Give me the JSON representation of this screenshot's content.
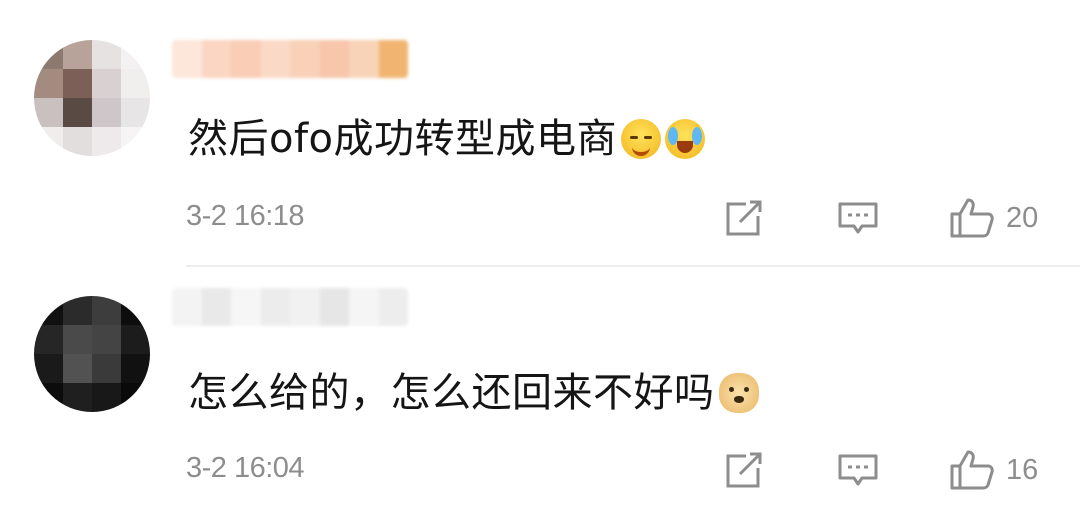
{
  "comments": [
    {
      "text": "然后ofo成功转型成电商",
      "emojis": [
        "sweat-smile-emoji",
        "crying-laughing-emoji"
      ],
      "time": "3-2 16:18",
      "likes": "20",
      "avatar_colors": [
        "#8c7a6e",
        "#b8a39a",
        "#e6e2e2",
        "#f3f1f1",
        "#a38b80",
        "#7c6058",
        "#d9d0d2",
        "#f1eeee",
        "#c9c0c0",
        "#5a4a44",
        "#cfc6ca",
        "#e8e5e6",
        "#f0eded",
        "#e2dede",
        "#eeeaeb",
        "#f6f4f4"
      ],
      "name_colors": [
        "#fde6da",
        "#fbd6c2",
        "#f9cdb6",
        "#fbd9c7",
        "#f8d1b8",
        "#f7c6ab",
        "#f8d3b7",
        "#f1b571"
      ]
    },
    {
      "text": "怎么给的，怎么还回来不好吗",
      "emojis": [
        "doge-emoji"
      ],
      "time": "3-2 16:04",
      "likes": "16",
      "avatar_colors": [
        "#101010",
        "#2b2b2b",
        "#3d3d3d",
        "#0d0d0d",
        "#262626",
        "#4a4a4a",
        "#444444",
        "#1c1c1c",
        "#1a1a1a",
        "#525252",
        "#3a3a3a",
        "#111111",
        "#0c0c0c",
        "#1f1f1f",
        "#181818",
        "#0a0a0a"
      ],
      "name_colors": [
        "#f3f3f3",
        "#e9e9e9",
        "#f6f6f6",
        "#ececec",
        "#f1f1f1",
        "#e6e6e6",
        "#f5f5f5",
        "#ededed"
      ]
    }
  ],
  "icons": {
    "share": "share-icon",
    "reply": "comment-icon",
    "like": "thumbs-up-icon"
  },
  "colors": {
    "meta_text": "#8d8d8d",
    "divider": "#ececec",
    "body_text": "#151515"
  }
}
